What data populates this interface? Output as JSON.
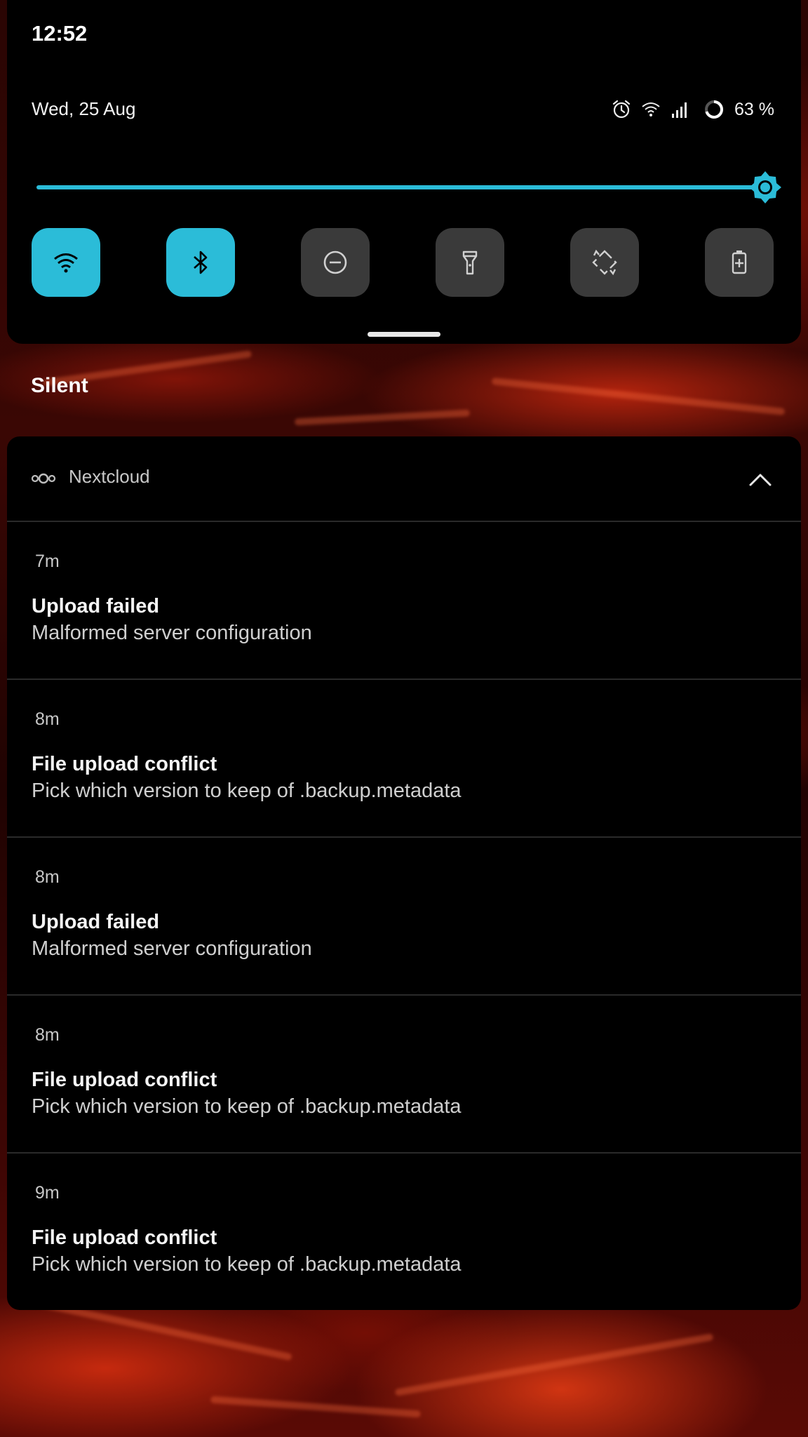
{
  "status_bar": {
    "time": "12:52"
  },
  "quick_settings": {
    "date": "Wed, 25 Aug",
    "battery_percent_text": "63 %",
    "brightness_level": 1.0,
    "accent_color": "#2bbcd8",
    "tiles": [
      {
        "name": "wifi-icon",
        "active": true
      },
      {
        "name": "bluetooth-icon",
        "active": true
      },
      {
        "name": "do-not-disturb-icon",
        "active": false
      },
      {
        "name": "flashlight-icon",
        "active": false
      },
      {
        "name": "auto-rotate-icon",
        "active": false
      },
      {
        "name": "battery-saver-icon",
        "active": false
      }
    ],
    "status_icons": [
      "alarm-icon",
      "wifi-icon",
      "signal-icon",
      "battery-ring-icon"
    ]
  },
  "section": {
    "label": "Silent"
  },
  "notification_group": {
    "app_name": "Nextcloud",
    "app_icon": "nextcloud-icon",
    "items": [
      {
        "time": "7m",
        "title": "Upload failed",
        "body": "Malformed server configuration"
      },
      {
        "time": "8m",
        "title": "File upload conflict",
        "body": "Pick which version to keep of .backup.metadata"
      },
      {
        "time": "8m",
        "title": "Upload failed",
        "body": "Malformed server configuration"
      },
      {
        "time": "8m",
        "title": "File upload conflict",
        "body": "Pick which version to keep of .backup.metadata"
      },
      {
        "time": "9m",
        "title": "File upload conflict",
        "body": "Pick which version to keep of .backup.metadata"
      }
    ]
  }
}
